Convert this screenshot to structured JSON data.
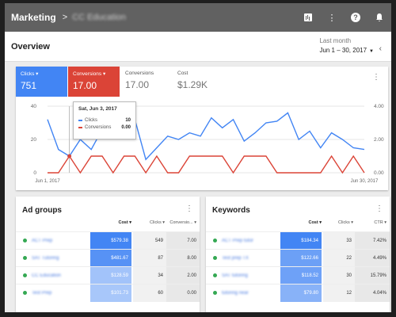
{
  "topbar": {
    "title": "Marketing",
    "breadcrumb": "CC Education"
  },
  "header": {
    "title": "Overview",
    "date_label": "Last month",
    "date_value": "Jun 1 – 30, 2017"
  },
  "metrics": [
    {
      "label": "Clicks",
      "value": "751",
      "color": "#4285f4"
    },
    {
      "label": "Conversions",
      "value": "17.00",
      "color": "#db4437"
    },
    {
      "label": "Conversions",
      "value": "17.00"
    },
    {
      "label": "Cost",
      "value": "$1.29K"
    }
  ],
  "tooltip": {
    "date": "Sat, Jun 3, 2017",
    "clicks_label": "Clicks",
    "clicks_value": "10",
    "conv_label": "Conversions",
    "conv_value": "0.00"
  },
  "chart_data": {
    "type": "line",
    "y_left_ticks": [
      "40",
      "20",
      "0"
    ],
    "y_right_ticks": [
      "4.00",
      "2.00",
      "0.00"
    ],
    "x_labels": [
      "Jun 1, 2017",
      "Jun 30, 2017"
    ],
    "ylim_left": [
      0,
      40
    ],
    "ylim_right": [
      0,
      4
    ],
    "series": [
      {
        "name": "Clicks",
        "color": "#4285f4",
        "axis": "left",
        "values": [
          32,
          14,
          10,
          20,
          14,
          26,
          23,
          31,
          32,
          8,
          15,
          22,
          20,
          24,
          22,
          33,
          27,
          32,
          19,
          24,
          30,
          31,
          36,
          20,
          25,
          15,
          24,
          20,
          15,
          14
        ]
      },
      {
        "name": "Conversions",
        "color": "#db4437",
        "axis": "left",
        "values": [
          0,
          0,
          10,
          0,
          10,
          10,
          0,
          10,
          10,
          0,
          10,
          0,
          0,
          10,
          10,
          10,
          10,
          0,
          10,
          10,
          10,
          0,
          0,
          0,
          0,
          0,
          10,
          0,
          10,
          0
        ]
      }
    ]
  },
  "adgroups": {
    "title": "Ad groups",
    "columns": [
      "Cost",
      "Clicks",
      "Conversio..."
    ],
    "rows": [
      {
        "name": "ACT Prep",
        "cost": "$579.38",
        "clicks": "549",
        "conv": "7.00"
      },
      {
        "name": "SAT Tutoring",
        "cost": "$481.67",
        "clicks": "87",
        "conv": "8.00"
      },
      {
        "name": "CC Education",
        "cost": "$128.59",
        "clicks": "34",
        "conv": "2.00"
      },
      {
        "name": "Test Prep",
        "cost": "$101.73",
        "clicks": "60",
        "conv": "0.00"
      }
    ]
  },
  "keywords": {
    "title": "Keywords",
    "columns": [
      "Cost",
      "Clicks",
      "CTR"
    ],
    "rows": [
      {
        "name": "ACT Prep tutor",
        "cost": "$184.34",
        "clicks": "33",
        "ctr": "7.42%"
      },
      {
        "name": "Test prep TX",
        "cost": "$122.66",
        "clicks": "22",
        "ctr": "4.49%"
      },
      {
        "name": "SAT tutoring",
        "cost": "$118.52",
        "clicks": "30",
        "ctr": "15.79%"
      },
      {
        "name": "tutoring near",
        "cost": "$79.80",
        "clicks": "12",
        "ctr": "4.04%"
      }
    ]
  }
}
